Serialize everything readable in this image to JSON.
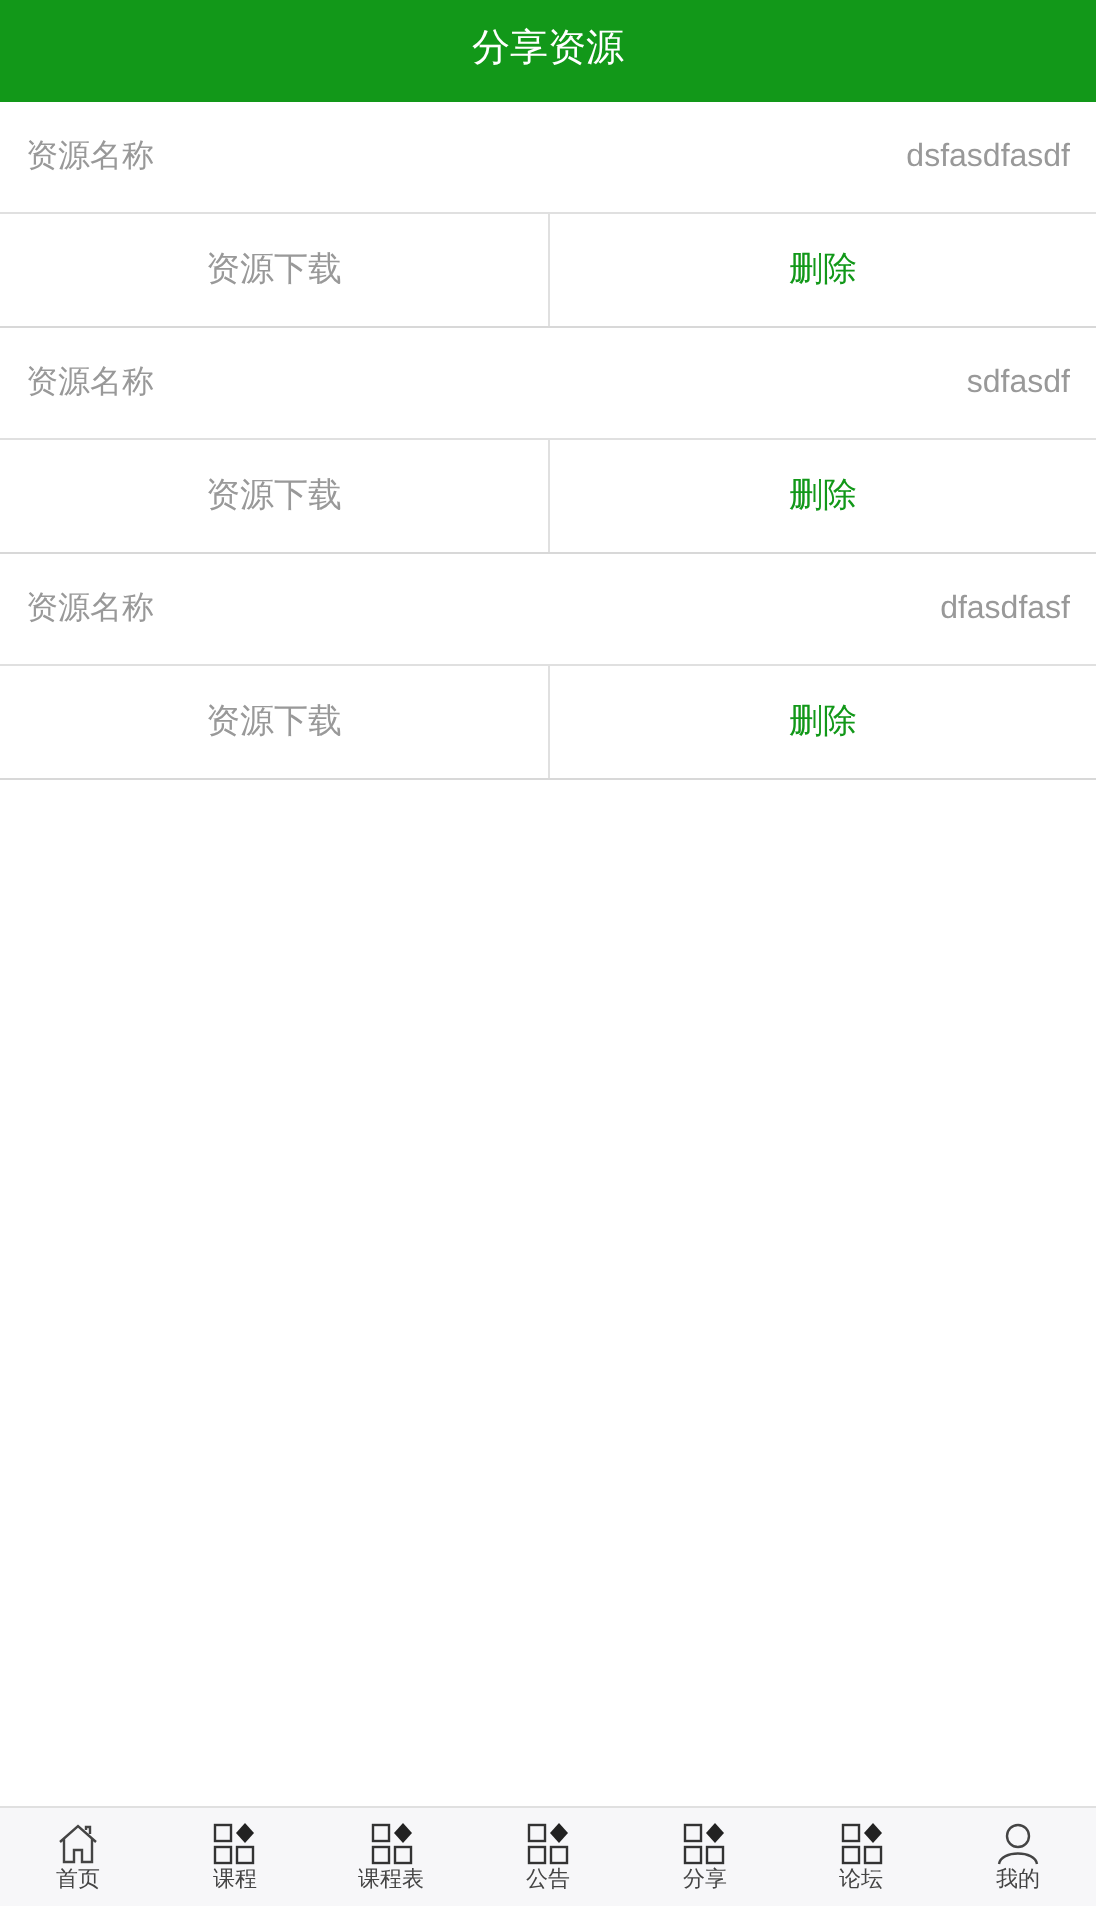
{
  "header": {
    "title": "分享资源"
  },
  "resources": [
    {
      "label": "资源名称",
      "name": "dsfasdfasdf",
      "download": "资源下载",
      "delete": "删除"
    },
    {
      "label": "资源名称",
      "name": "sdfasdf",
      "download": "资源下载",
      "delete": "删除"
    },
    {
      "label": "资源名称",
      "name": "dfasdfasf",
      "download": "资源下载",
      "delete": "删除"
    }
  ],
  "tab_bar": [
    {
      "label": "首页",
      "kind": "home"
    },
    {
      "label": "课程",
      "kind": "grid"
    },
    {
      "label": "课程表",
      "kind": "grid"
    },
    {
      "label": "公告",
      "kind": "grid"
    },
    {
      "label": "分享",
      "kind": "grid"
    },
    {
      "label": "论坛",
      "kind": "grid"
    },
    {
      "label": "我的",
      "kind": "person"
    }
  ]
}
